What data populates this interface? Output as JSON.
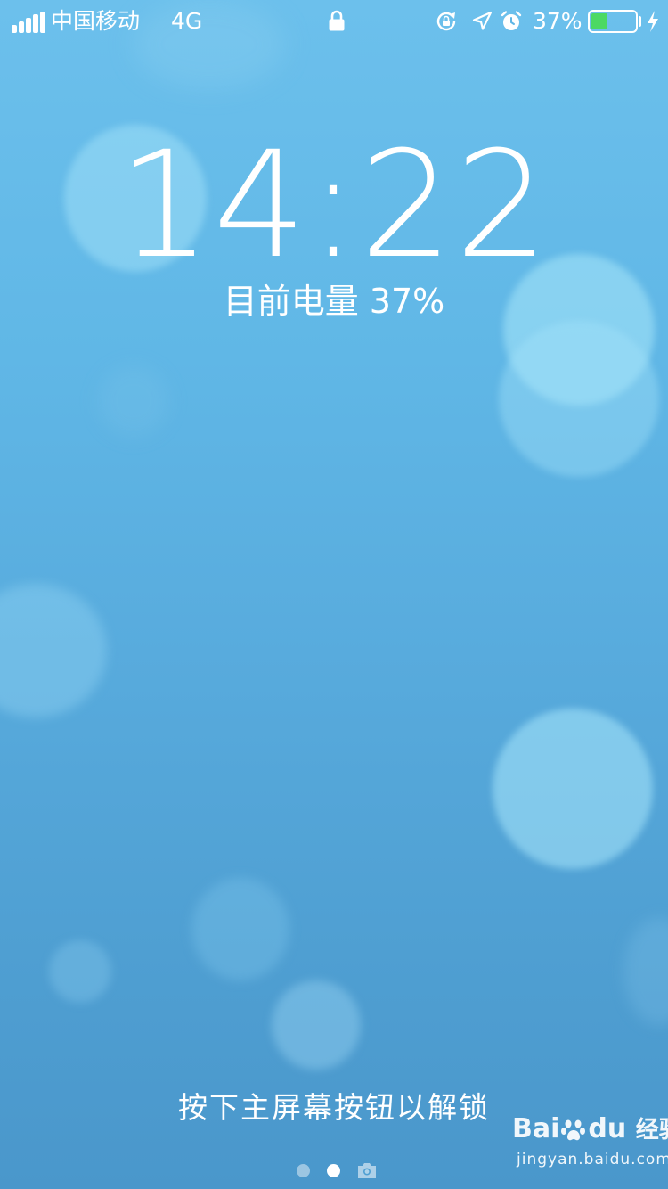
{
  "status_bar": {
    "carrier": "中国移动",
    "network": "4G",
    "battery_percent": "37%",
    "battery_level": 0.37,
    "battery_color": "#4cd964",
    "icons": [
      "signal-icon",
      "lock-icon",
      "rotation-lock-icon",
      "location-icon",
      "alarm-icon",
      "battery-icon",
      "charging-bolt-icon"
    ]
  },
  "lock_screen": {
    "time": "14:22",
    "battery_status": "目前电量 37%",
    "unlock_hint": "按下主屏幕按钮以解锁"
  },
  "page_indicator": {
    "pages": 2,
    "active_page": 2,
    "trailing_icon": "camera-icon"
  },
  "watermark": {
    "logo_text_left": "Bai",
    "logo_text_right": "du",
    "logo_cn": "经验",
    "url": "jingyan.baidu.com"
  },
  "colors": {
    "background_top": "#6cc0ec",
    "background_bottom": "#4a97cb",
    "text": "#ffffff"
  }
}
